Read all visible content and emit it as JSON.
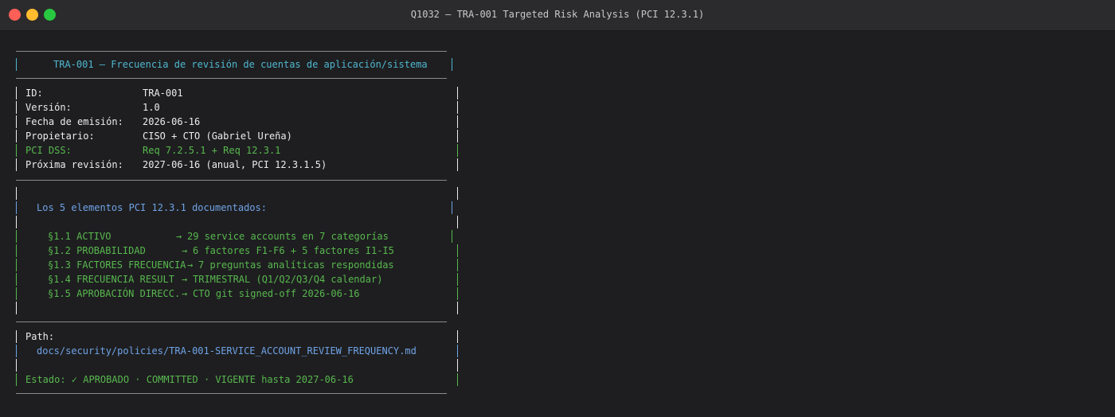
{
  "window": {
    "title": "Q1032 — TRA-001 Targeted Risk Analysis (PCI 12.3.1)"
  },
  "doc": {
    "header": "TRA-001 — Frecuencia de revisión de cuentas de aplicación/sistema",
    "fields": [
      {
        "label": "ID:",
        "value": "TRA-001"
      },
      {
        "label": "Versión:",
        "value": "1.0"
      },
      {
        "label": "Fecha de emisión:",
        "value": "2026-06-16"
      },
      {
        "label": "Propietario:",
        "value": "CISO + CTO (Gabriel Ureña)"
      },
      {
        "label": "PCI DSS:",
        "value": "Req 7.2.5.1 + Req 12.3.1"
      },
      {
        "label": "Próxima revisión:",
        "value": "2027-06-16 (anual, PCI 12.3.1.5)"
      }
    ],
    "elements_heading": "Los 5 elementos PCI 12.3.1 documentados:",
    "elements": [
      {
        "name": "§1.1 ACTIVO",
        "detail": "29 service accounts en 7 categorías"
      },
      {
        "name": "§1.2 PROBABILIDAD",
        "detail": "6 factores F1-F6 + 5 factores I1-I5"
      },
      {
        "name": "§1.3 FACTORES FRECUENCIA",
        "detail": "7 preguntas analíticas respondidas"
      },
      {
        "name": "§1.4 FRECUENCIA RESULT",
        "detail": "TRIMESTRAL (Q1/Q2/Q3/Q4 calendar)"
      },
      {
        "name": "§1.5 APROBACIÓN DIRECC.",
        "detail": "CTO git signed-off 2026-06-16"
      }
    ],
    "arrow": "→",
    "path_label": "Path:",
    "path_value": "docs/security/policies/TRA-001-SERVICE_ACCOUNT_REVIEW_FREQUENCY.md",
    "status": "Estado: ✓ APROBADO · COMMITTED · VIGENTE hasta 2027-06-16"
  },
  "colors": {
    "background": "#1e1e20",
    "titlebar": "#2b2b2d",
    "cyan": "#4fb7d0",
    "blue": "#6fa3e6",
    "green": "#58b84e",
    "white": "#ececec",
    "border": "#8a8a8a"
  }
}
